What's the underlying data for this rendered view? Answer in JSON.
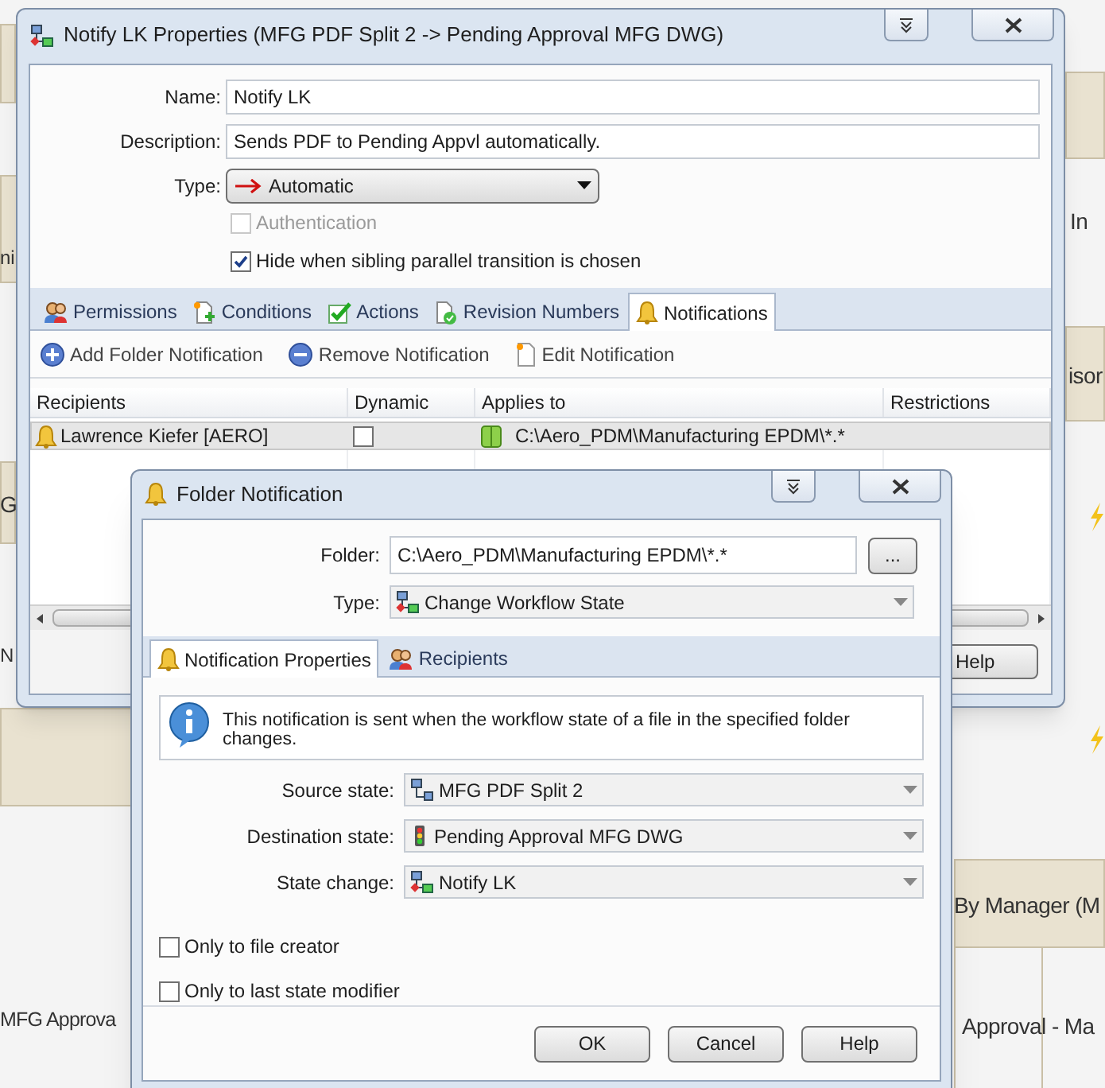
{
  "canvas_fragments": [
    {
      "text": "ni"
    },
    {
      "text": "G"
    },
    {
      "text": "N"
    },
    {
      "text": "MFG Approva"
    },
    {
      "text": "In"
    },
    {
      "text": "isor"
    },
    {
      "text": "By Manager (M"
    },
    {
      "text": "Approval - Ma"
    }
  ],
  "main_window": {
    "title": "Notify LK Properties (MFG PDF Split 2 -> Pending Approval MFG DWG)",
    "fields": [
      {
        "label": "Name:",
        "value": "Notify LK"
      },
      {
        "label": "Description:",
        "value": "Sends PDF to Pending Appvl automatically."
      }
    ],
    "type_label": "Type:",
    "type": "Automatic",
    "checkboxes": [
      {
        "label": "Authentication",
        "checked": false,
        "disabled": true
      },
      {
        "label": "Hide when sibling parallel transition is chosen",
        "checked": true,
        "disabled": false
      }
    ],
    "tabs": [
      {
        "label": "Permissions",
        "selected": false
      },
      {
        "label": "Conditions",
        "selected": false
      },
      {
        "label": "Actions",
        "selected": false
      },
      {
        "label": "Revision Numbers",
        "selected": false
      },
      {
        "label": "Notifications",
        "selected": true
      }
    ],
    "toolbar": [
      "Add Folder Notification",
      "Remove Notification",
      "Edit Notification"
    ],
    "table": {
      "columns": [
        "Recipients",
        "Dynamic",
        "Applies to",
        "Restrictions"
      ],
      "rows": [
        {
          "recipient": "Lawrence Kiefer [AERO]",
          "dynamic": false,
          "applies_to": "C:\\Aero_PDM\\Manufacturing EPDM\\*.*",
          "selected": true
        }
      ]
    },
    "buttons": [
      "Help"
    ]
  },
  "dialog": {
    "title": "Folder Notification",
    "folder_label": "Folder:",
    "folder": "C:\\Aero_PDM\\Manufacturing EPDM\\*.*",
    "browse": "...",
    "type_label": "Type:",
    "type": "Change Workflow State",
    "tabs": [
      {
        "label": "Notification Properties",
        "selected": true
      },
      {
        "label": "Recipients",
        "selected": false
      }
    ],
    "info": "This notification is sent when the workflow state of a file in the specified folder changes.",
    "selects": [
      {
        "label": "Source state:",
        "value": "MFG PDF Split 2"
      },
      {
        "label": "Destination state:",
        "value": "Pending Approval MFG DWG"
      },
      {
        "label": "State change:",
        "value": "Notify LK"
      }
    ],
    "checkboxes": [
      {
        "label": "Only to file creator",
        "checked": false
      },
      {
        "label": "Only to last state modifier",
        "checked": false
      }
    ],
    "buttons": [
      "OK",
      "Cancel",
      "Help"
    ]
  }
}
